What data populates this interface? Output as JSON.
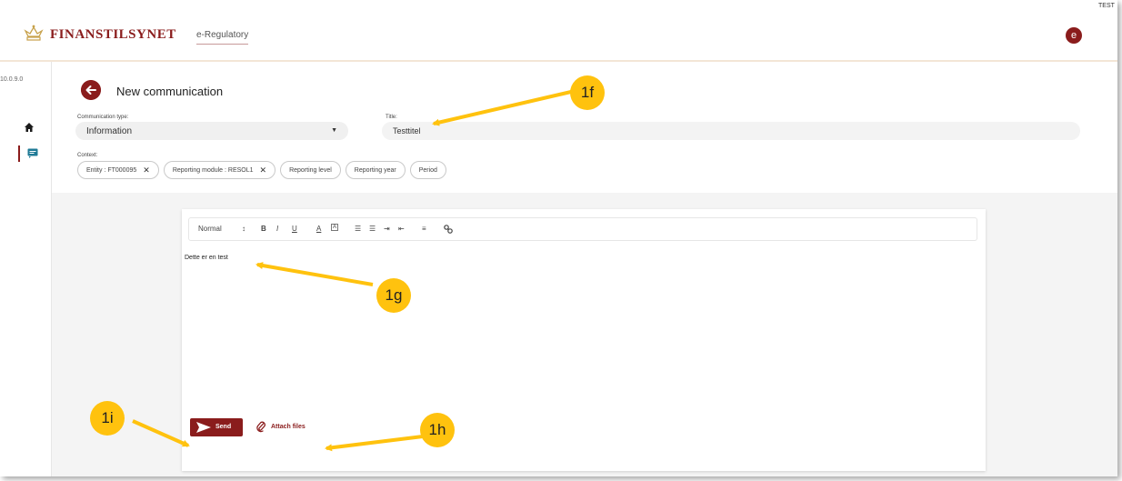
{
  "header": {
    "brand": "FINANSTILSYNET",
    "nav_tab": "e-Regulatory",
    "avatar_initial": "e",
    "env_label": "TEST"
  },
  "sidebar": {
    "version": "10.0.9.0",
    "items": [
      {
        "icon": "home-icon"
      },
      {
        "icon": "chat-icon",
        "active": true
      }
    ]
  },
  "form": {
    "title": "New communication",
    "communication_type_label": "Communication type:",
    "communication_type_value": "Information",
    "title_label": "Title:",
    "title_value": "Testtitel",
    "context_label": "Context:",
    "context_chips": [
      {
        "label": "Entity : FT000095",
        "removable": true
      },
      {
        "label": "Reporting module : RESOL1",
        "removable": true
      },
      {
        "label": "Reporting level",
        "removable": false
      },
      {
        "label": "Reporting year",
        "removable": false
      },
      {
        "label": "Period",
        "removable": false
      }
    ]
  },
  "editor": {
    "toolbar": {
      "format": "Normal",
      "caret": "↕",
      "bold": "B",
      "italic": "I",
      "underline": "U",
      "font_color": "A",
      "background": "A",
      "ordered_list": "☰",
      "bullet_list": "☰",
      "indent_in": "⇥",
      "indent_out": "⇤",
      "align": "≡",
      "link": "🔗"
    },
    "body_text": "Dette er en test",
    "send_label": "Send",
    "attach_label": "Attach files"
  },
  "callouts": [
    "1f",
    "1g",
    "1h",
    "1i"
  ],
  "colors": {
    "brand": "#8a1c1c",
    "callout": "#ffc20e",
    "content_bg": "#f4f4f4"
  }
}
